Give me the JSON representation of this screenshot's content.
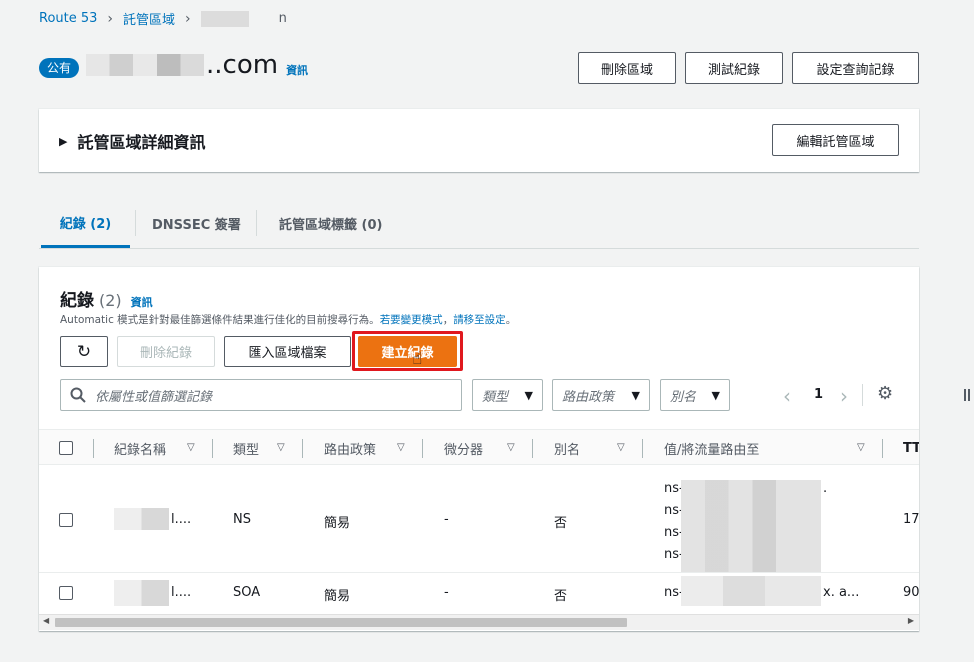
{
  "breadcrumb": {
    "root": "Route 53",
    "hosted_zones": "託管區域",
    "tail": "n"
  },
  "zone": {
    "badge": "公有",
    "name_suffix": "..com",
    "info": "資訊"
  },
  "actions": {
    "delete_zone": "刪除區域",
    "test_record": "測試紀錄",
    "query_logging": "設定查詢記錄"
  },
  "details": {
    "title": "託管區域詳細資訊",
    "edit": "編輯託管區域"
  },
  "tabs": [
    {
      "label": "紀錄 (2)"
    },
    {
      "label": "DNSSEC 簽署"
    },
    {
      "label": "託管區域標籤 (0)"
    }
  ],
  "records": {
    "title": "紀錄",
    "count": "(2)",
    "info": "資訊",
    "desc": "Automatic 模式是針對最佳篩選條件結果進行佳化的目前搜尋行為。",
    "desc_link1": "若要變更模式",
    "desc_mid": "，",
    "desc_link2": "請移至設定",
    "desc_end": "。",
    "delete_btn": "刪除紀錄",
    "import_btn": "匯入區域檔案",
    "create_btn": "建立紀錄",
    "search_placeholder": "依屬性或值篩選記錄",
    "filter_type": "類型",
    "filter_policy": "路由政策",
    "filter_alias": "別名",
    "page": "1",
    "columns": [
      "紀錄名稱",
      "類型",
      "路由政策",
      "微分器",
      "別名",
      "值/將流量路由至",
      "TT"
    ],
    "rows": [
      {
        "name": "l....",
        "type": "NS",
        "policy": "簡易",
        "diff": "-",
        "alias": "否",
        "values": [
          "ns-",
          "ns-",
          "ns-",
          "ns-"
        ],
        "value_suffix": ".",
        "ttl": "17"
      },
      {
        "name": "l....",
        "type": "SOA",
        "policy": "簡易",
        "diff": "-",
        "alias": "否",
        "values": [
          "ns-"
        ],
        "value_suffix": "x. a...",
        "ttl": "90"
      }
    ]
  },
  "colors": {
    "accent": "#0073bb",
    "primary": "#ec7211",
    "highlight": "#e0181e"
  }
}
